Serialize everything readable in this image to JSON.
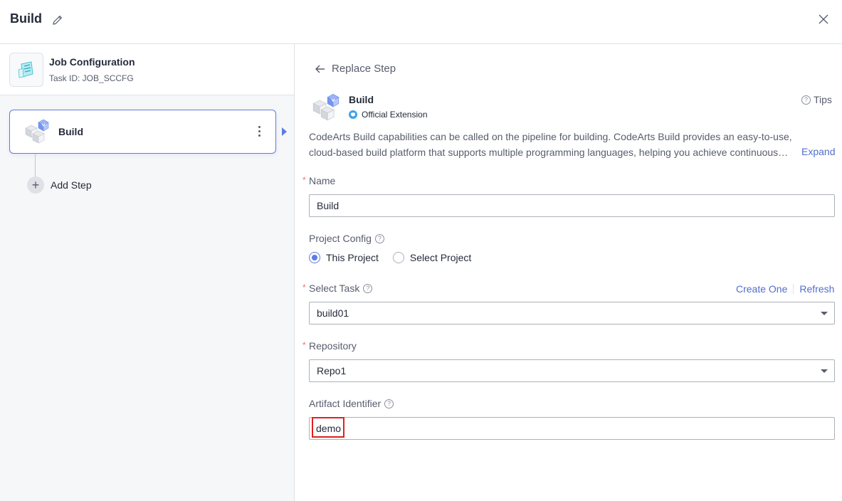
{
  "header": {
    "title": "Build"
  },
  "job": {
    "title": "Job Configuration",
    "task_id": "Task ID: JOB_SCCFG"
  },
  "steps": [
    {
      "label": "Build"
    }
  ],
  "add_step_label": "Add Step",
  "panel": {
    "back_label": "Replace Step",
    "extension_title": "Build",
    "extension_badge": "Official Extension",
    "tips_label": "Tips",
    "description_line1": "CodeArts Build capabilities can be called on the pipeline for building. CodeArts Build provides an easy-to-use,",
    "description_line2": "cloud-based build platform that supports multiple programming languages, helping you achieve continuous…",
    "expand_label": "Expand"
  },
  "form": {
    "name": {
      "label": "Name",
      "value": "Build",
      "required": true
    },
    "project_config": {
      "label": "Project Config",
      "options": [
        "This Project",
        "Select Project"
      ],
      "selected": "This Project"
    },
    "select_task": {
      "label": "Select Task",
      "value": "build01",
      "required": true,
      "create_label": "Create One",
      "refresh_label": "Refresh"
    },
    "repository": {
      "label": "Repository",
      "value": "Repo1",
      "required": true
    },
    "artifact_identifier": {
      "label": "Artifact Identifier",
      "value": "demo"
    }
  },
  "colors": {
    "accent": "#5e7ce0",
    "link": "#526ecc",
    "required": "#f66f6a",
    "highlight": "#e02020"
  },
  "icons": [
    "edit-icon",
    "close-icon",
    "cube-icon",
    "more-vertical-icon",
    "arrow-left-icon",
    "help-icon",
    "plus-icon",
    "chevron-down-icon"
  ]
}
